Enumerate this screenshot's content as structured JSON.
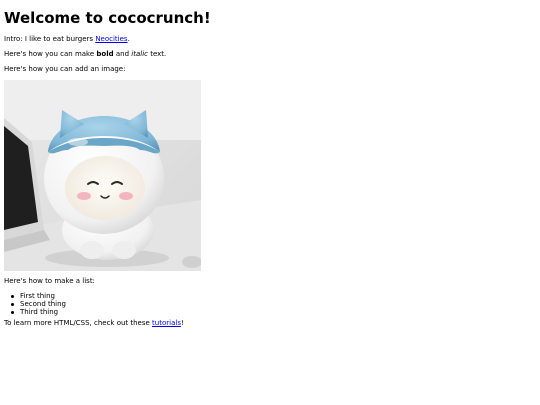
{
  "title": "Welcome to cococrunch!",
  "intro": {
    "prefix": "Intro: I like to eat burgers ",
    "link": "Neocities",
    "suffix": "."
  },
  "formatting": {
    "prefix": "Here's how you can make ",
    "bold": "bold",
    "middle": " and ",
    "italic": "italic",
    "suffix": " text."
  },
  "image_intro": "Here's how you can add an image:",
  "list_intro": "Here's how to make a list:",
  "list": [
    "First thing",
    "Second thing",
    "Third thing"
  ],
  "outro": {
    "prefix": "To learn more HTML/CSS, check out these ",
    "link": "tutorials",
    "suffix": "!"
  },
  "colors": {
    "link": "#0000ee",
    "figure_hat": "#7fb7d6",
    "figure_body": "#f4f4f4"
  }
}
